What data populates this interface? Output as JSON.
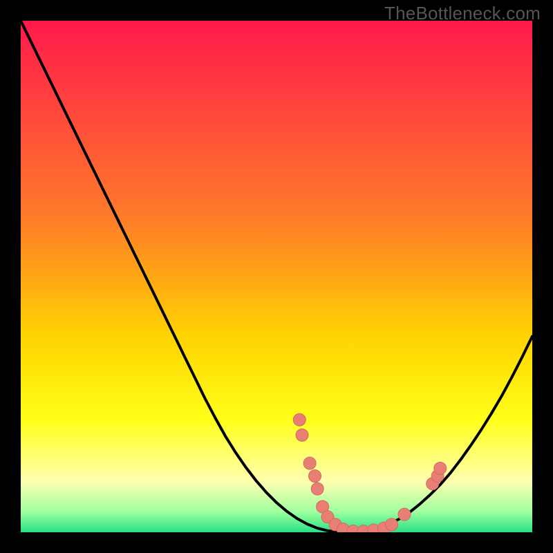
{
  "watermark": "TheBottleneck.com",
  "colors": {
    "frame": "#000000",
    "curve": "#000000",
    "dot_fill": "#e77f74",
    "dot_stroke": "#d46a60",
    "grad_top": "#ff1a4b",
    "grad_mid1": "#ff6a2f",
    "grad_mid2": "#ffd400",
    "grad_yellow": "#ffff1a",
    "grad_lightyellow": "#ffffb0",
    "grad_green": "#27e183"
  },
  "chart_data": {
    "type": "line",
    "title": "",
    "xlabel": "",
    "ylabel": "",
    "xlim": [
      0,
      100
    ],
    "ylim": [
      0,
      100
    ],
    "x": [
      0,
      2,
      4,
      6,
      8,
      10,
      12,
      14,
      16,
      18,
      20,
      22,
      24,
      26,
      28,
      30,
      32,
      34,
      36,
      38,
      40,
      42,
      44,
      46,
      48,
      50,
      52,
      54,
      56,
      58,
      60,
      62,
      64,
      66,
      68,
      70,
      72,
      74,
      76,
      78,
      80,
      82,
      84,
      86,
      88,
      90,
      92,
      94,
      96,
      98,
      100
    ],
    "values": [
      100,
      95.9,
      91.8,
      87.7,
      83.6,
      79.5,
      75.4,
      71.3,
      67.2,
      63.1,
      59.0,
      54.9,
      50.8,
      46.7,
      42.6,
      38.5,
      34.4,
      30.3,
      26.2,
      22.4,
      18.8,
      15.6,
      12.7,
      10.1,
      7.8,
      5.8,
      4.1,
      2.7,
      1.6,
      0.8,
      0.3,
      0.05,
      0.0,
      0.1,
      0.4,
      0.9,
      1.6,
      2.6,
      3.9,
      5.5,
      7.3,
      9.3,
      11.6,
      14.2,
      17.0,
      20.0,
      23.2,
      26.6,
      30.3,
      34.2,
      38.3
    ],
    "dots": [
      {
        "x": 54.5,
        "y": 22.0
      },
      {
        "x": 55.0,
        "y": 19.0
      },
      {
        "x": 56.5,
        "y": 13.5
      },
      {
        "x": 57.5,
        "y": 11.0
      },
      {
        "x": 58.0,
        "y": 8.5
      },
      {
        "x": 59.0,
        "y": 5.0
      },
      {
        "x": 60.0,
        "y": 3.0
      },
      {
        "x": 61.5,
        "y": 1.5
      },
      {
        "x": 63.0,
        "y": 0.6
      },
      {
        "x": 65.0,
        "y": 0.2
      },
      {
        "x": 67.0,
        "y": 0.2
      },
      {
        "x": 69.0,
        "y": 0.4
      },
      {
        "x": 71.0,
        "y": 0.8
      },
      {
        "x": 72.5,
        "y": 1.5
      },
      {
        "x": 75.0,
        "y": 3.5
      },
      {
        "x": 80.5,
        "y": 9.5
      },
      {
        "x": 81.5,
        "y": 11.0
      },
      {
        "x": 82.0,
        "y": 12.5
      }
    ]
  }
}
